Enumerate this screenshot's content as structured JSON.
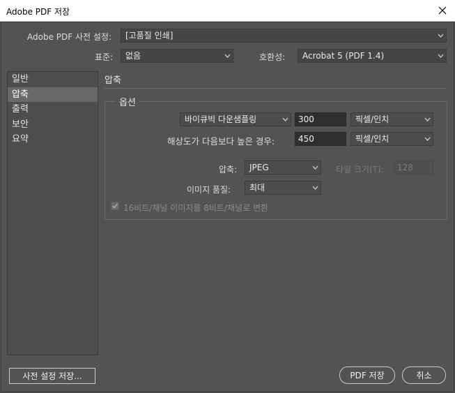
{
  "window": {
    "title": "Adobe PDF 저장",
    "close_glyph": "✕"
  },
  "top": {
    "preset_label": "Adobe PDF 사전 설정:",
    "preset_value": "[고품질 인쇄]",
    "standard_label": "표준:",
    "standard_value": "없음",
    "compat_label": "호환성:",
    "compat_value": "Acrobat 5 (PDF 1.4)"
  },
  "sidebar": {
    "items": [
      {
        "label": "일반",
        "selected": false
      },
      {
        "label": "압축",
        "selected": true
      },
      {
        "label": "출력",
        "selected": false
      },
      {
        "label": "보안",
        "selected": false
      },
      {
        "label": "요약",
        "selected": false
      }
    ]
  },
  "section": {
    "title": "압축"
  },
  "options": {
    "legend": "옵션",
    "resample_method": "바이큐빅 다운샘플링",
    "resample_value": "300",
    "resample_unit": "픽셀/인치",
    "threshold_label": "해상도가 다음보다 높은 경우:",
    "threshold_value": "450",
    "threshold_unit": "픽셀/인치",
    "compression_label": "압축:",
    "compression_value": "JPEG",
    "tile_label": "타일 크기(T):",
    "tile_value": "128",
    "quality_label": "이미지 품질:",
    "quality_value": "최대",
    "convert_label": "16비트/채널 이미지를 8비트/채널로 변환",
    "convert_checked": true
  },
  "footer": {
    "save_preset": "사전 설정 저장...",
    "save_pdf": "PDF 저장",
    "cancel": "취소"
  },
  "colors": {
    "bg": "#535353",
    "panel": "#4d4d4d",
    "selected": "#696969",
    "field": "#2f2f2f"
  }
}
